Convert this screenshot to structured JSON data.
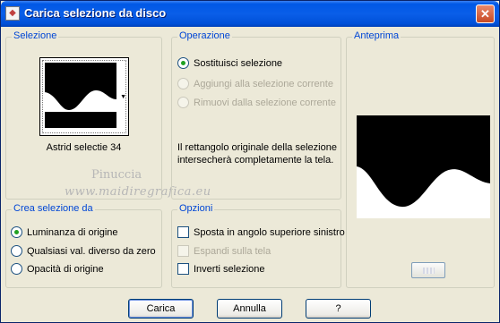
{
  "window": {
    "title": "Carica selezione da disco",
    "close_symbol": "✕",
    "icon": "app-icon"
  },
  "selezione": {
    "group_title": "Selezione",
    "selection_name": "Astrid selectie 34",
    "watermark_line1": "Pinuccia",
    "watermark_line2": "www.maidiregrafica.eu"
  },
  "operazione": {
    "group_title": "Operazione",
    "options": [
      {
        "label": "Sostituisci selezione",
        "checked": true,
        "enabled": true
      },
      {
        "label": "Aggiungi alla selezione corrente",
        "checked": false,
        "enabled": false
      },
      {
        "label": "Rimuovi dalla selezione corrente",
        "checked": false,
        "enabled": false
      }
    ],
    "description": "Il rettangolo originale della selezione intersecherà completamente la tela."
  },
  "crea": {
    "group_title": "Crea selezione da",
    "options": [
      {
        "label": "Luminanza di origine",
        "checked": true
      },
      {
        "label": "Qualsiasi val. diverso da zero",
        "checked": false
      },
      {
        "label": "Opacità di origine",
        "checked": false
      }
    ]
  },
  "opzioni": {
    "group_title": "Opzioni",
    "options": [
      {
        "label": "Sposta in angolo superiore sinistro",
        "checked": false,
        "enabled": true
      },
      {
        "label": "Espandi sulla tela",
        "checked": false,
        "enabled": false
      },
      {
        "label": "Inverti selezione",
        "checked": false,
        "enabled": true
      }
    ]
  },
  "anteprima": {
    "group_title": "Anteprima"
  },
  "buttons": {
    "carica": "Carica",
    "annulla": "Annulla",
    "help": "?"
  },
  "colors": {
    "titlebar": "#0058e6",
    "group_title": "#0046d5",
    "dialog_bg": "#ece9d8",
    "radio_dot": "#21a121"
  }
}
